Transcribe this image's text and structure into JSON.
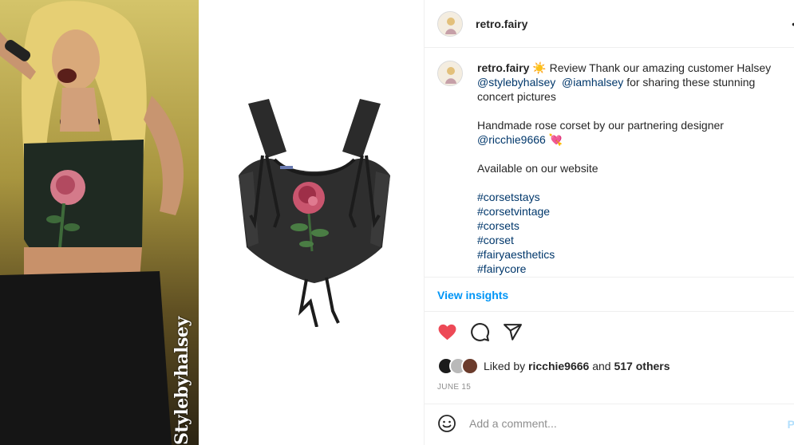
{
  "media": {
    "watermark": "Stylebyhalsey"
  },
  "header": {
    "username": "retro.fairy",
    "more_label": "•"
  },
  "caption": {
    "username": "retro.fairy",
    "sun_emoji": "☀️",
    "line1_text": "Review Thank our amazing customer Halsey",
    "mention1": "@stylebyhalsey",
    "mention2": "@iamhalsey",
    "line2_tail": "for sharing these stunning concert",
    "line3": "pictures",
    "para2_prefix": "Handmade rose corset by our partnering designer",
    "mention3": "@ricchie9666",
    "heart_emoji": "💘",
    "para3": "Available on our website",
    "hashtags": [
      "#corsetstays",
      "#corsetvintage",
      "#corsets",
      "#corset",
      "#fairyaesthetics",
      "#fairycore"
    ]
  },
  "insights_label": "View insights",
  "actions": {
    "like_icon": "heart-filled-icon",
    "comment_icon": "comment-icon",
    "share_icon": "share-icon",
    "like_color": "#ed4956"
  },
  "likes": {
    "prefix": "Liked by",
    "user": "ricchie9666",
    "and": "and",
    "others": "517 others"
  },
  "date": "JUNE 15",
  "comment": {
    "placeholder": "Add a comment...",
    "post_label": "P"
  },
  "colors": {
    "link": "#00376b",
    "insights": "#0095f6",
    "muted": "#8e8e8e"
  }
}
